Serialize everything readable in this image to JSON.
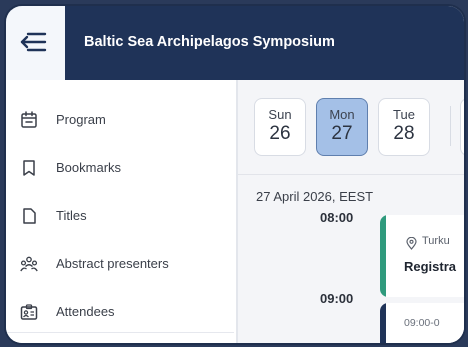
{
  "header": {
    "title": "Baltic Sea Archipelagos Symposium",
    "menu_icon": "collapse-menu-icon"
  },
  "sidebar": {
    "items": [
      {
        "label": "Program",
        "icon": "calendar-icon"
      },
      {
        "label": "Bookmarks",
        "icon": "bookmark-icon"
      },
      {
        "label": "Titles",
        "icon": "document-icon"
      },
      {
        "label": "Abstract presenters",
        "icon": "people-group-icon"
      },
      {
        "label": "Attendees",
        "icon": "badge-icon"
      }
    ]
  },
  "days": [
    {
      "name": "Sun",
      "num": "26",
      "selected": false
    },
    {
      "name": "Mon",
      "num": "27",
      "selected": true
    },
    {
      "name": "Tue",
      "num": "28",
      "selected": false
    }
  ],
  "schedule": {
    "date_header": "27 April 2026, EEST",
    "times": [
      "08:00",
      "09:00"
    ],
    "sessions": [
      {
        "location": "Turku",
        "title": "Registra",
        "accent": "#2f9a7d",
        "location_icon": "location-pin-icon"
      },
      {
        "time": "09:00-0",
        "accent": "#1f3358"
      }
    ]
  },
  "colors": {
    "header_bg": "#1f3358",
    "selected_day": "#a4c0e7",
    "accent_green": "#2f9a7d"
  }
}
